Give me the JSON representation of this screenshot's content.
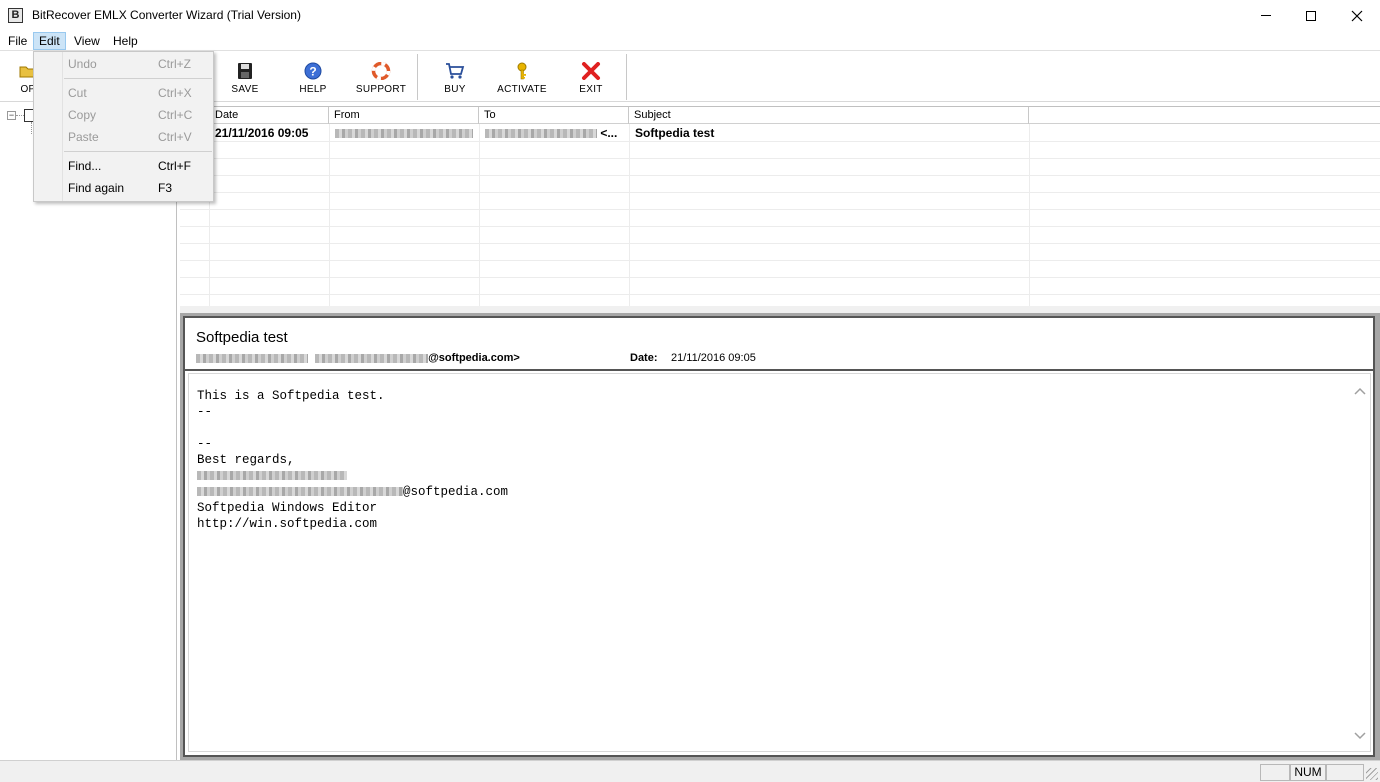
{
  "window": {
    "title": "BitRecover EMLX Converter Wizard (Trial Version)",
    "app_icon_letter": "B"
  },
  "menubar": {
    "items": [
      {
        "label": "File"
      },
      {
        "label": "Edit"
      },
      {
        "label": "View"
      },
      {
        "label": "Help"
      }
    ]
  },
  "edit_menu": {
    "items": [
      {
        "label": "Undo",
        "shortcut": "Ctrl+Z",
        "enabled": false
      },
      {
        "label": "Cut",
        "shortcut": "Ctrl+X",
        "enabled": false
      },
      {
        "label": "Copy",
        "shortcut": "Ctrl+C",
        "enabled": false
      },
      {
        "label": "Paste",
        "shortcut": "Ctrl+V",
        "enabled": false
      },
      {
        "label": "Find...",
        "shortcut": "Ctrl+F",
        "enabled": true
      },
      {
        "label": "Find again",
        "shortcut": "F3",
        "enabled": true
      }
    ]
  },
  "toolbar": {
    "open_partial": "OP",
    "save": "SAVE",
    "help": "HELP",
    "support": "SUPPORT",
    "buy": "BUY",
    "activate": "ACTIVATE",
    "exit": "EXIT"
  },
  "grid": {
    "columns": [
      "Date",
      "From",
      "To",
      "Subject"
    ],
    "rows": [
      {
        "date": "21/11/2016 09:05",
        "from": "",
        "to_suffix": "<...",
        "subject": "Softpedia test"
      }
    ]
  },
  "preview": {
    "subject": "Softpedia test",
    "from_suffix": "@softpedia.com>",
    "date_label": "Date:",
    "date_value": "21/11/2016 09:05",
    "body_lines": {
      "l1": "This is a Softpedia test.",
      "l2": "--",
      "l3": "--",
      "l4": "Best regards,",
      "l5_suffix": "@softpedia.com",
      "l6": "Softpedia Windows Editor",
      "l7": "http://win.softpedia.com"
    }
  },
  "statusbar": {
    "num": "NUM"
  },
  "colors": {
    "menu_active_bg": "#cce4f7",
    "exit_icon": "#e02020",
    "help_icon": "#3d6fd6",
    "activate_icon": "#e8b400",
    "support_icon": "#e05a2a"
  }
}
